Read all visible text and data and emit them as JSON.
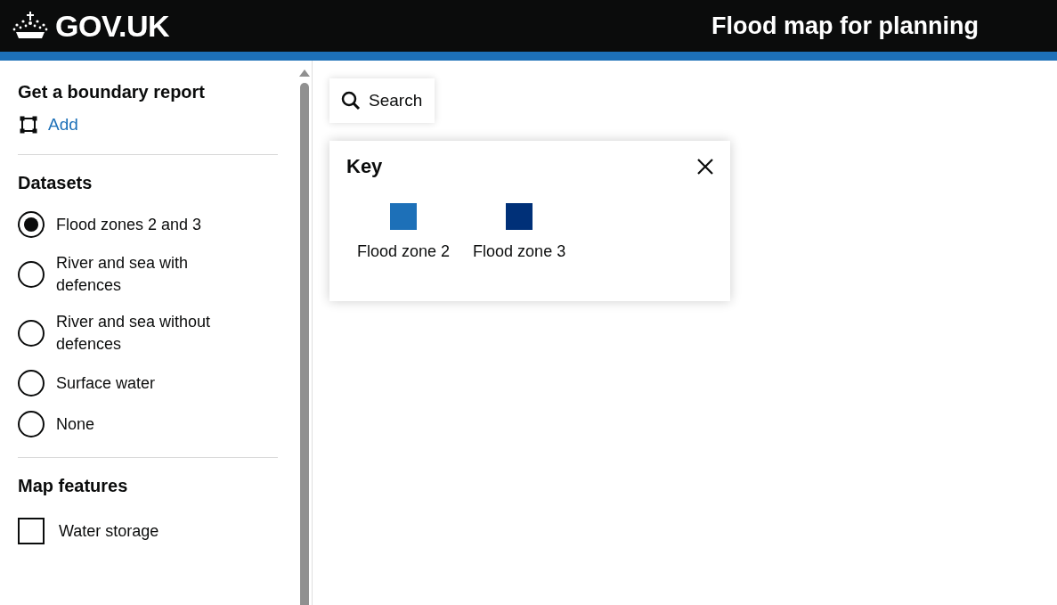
{
  "header": {
    "logo": "GOV.UK",
    "title": "Flood map for planning"
  },
  "sidebar": {
    "boundary": {
      "heading": "Get a boundary report",
      "action": "Add"
    },
    "datasets": {
      "heading": "Datasets",
      "options": [
        {
          "label": "Flood zones 2 and 3",
          "selected": true
        },
        {
          "label": "River and sea with defences",
          "selected": false
        },
        {
          "label": "River and sea without defences",
          "selected": false
        },
        {
          "label": "Surface water",
          "selected": false
        },
        {
          "label": "None",
          "selected": false
        }
      ]
    },
    "map_features": {
      "heading": "Map features",
      "items": [
        {
          "label": "Water storage",
          "checked": false
        }
      ]
    }
  },
  "map": {
    "search": {
      "label": "Search"
    },
    "key": {
      "title": "Key",
      "items": [
        {
          "label": "Flood zone 2",
          "color": "#1d70b8"
        },
        {
          "label": "Flood zone 3",
          "color": "#003078"
        }
      ]
    }
  }
}
